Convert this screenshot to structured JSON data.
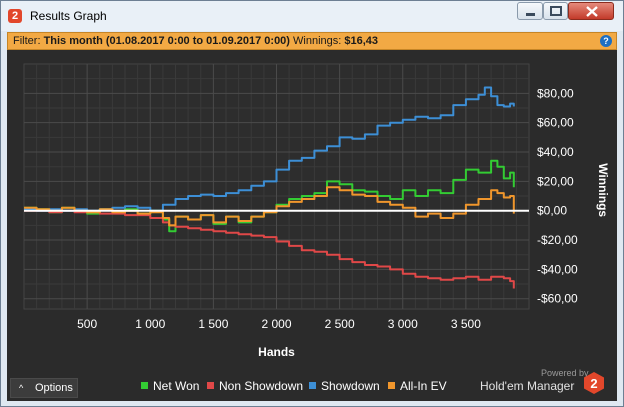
{
  "window": {
    "title": "Results Graph",
    "app_icon_glyph": "2",
    "controls": [
      "minimize-icon",
      "maximize-icon",
      "close-icon"
    ]
  },
  "filter": {
    "prefix": "Filter:",
    "range": "This month (01.08.2017 0:00 to 01.09.2017 0:00)",
    "winnings_label": "Winnings:",
    "winnings_value": "$16,43",
    "help_glyph": "?"
  },
  "chart_data": {
    "type": "line",
    "xlabel": "Hands",
    "ylabel": "Winnings",
    "x_ticks": [
      "500",
      "1 000",
      "1 500",
      "2 000",
      "2 500",
      "3 000",
      "3 500"
    ],
    "x_tick_values": [
      500,
      1000,
      1500,
      2000,
      2500,
      3000,
      3500
    ],
    "y_ticks": [
      "$80,00",
      "$60,00",
      "$40,00",
      "$20,00",
      "$0,00",
      "-$20,00",
      "-$40,00",
      "-$60,00"
    ],
    "y_tick_values": [
      80,
      60,
      40,
      20,
      0,
      -20,
      -40,
      -60
    ],
    "xlim": [
      0,
      4000
    ],
    "ylim": [
      -67,
      100
    ],
    "grid": true,
    "zero_line": true,
    "legend_position": "bottom-right",
    "series": [
      {
        "name": "Net Won",
        "color": "#33cc33",
        "points": [
          [
            0,
            2
          ],
          [
            100,
            1
          ],
          [
            200,
            -1
          ],
          [
            300,
            2
          ],
          [
            400,
            0
          ],
          [
            500,
            -2
          ],
          [
            600,
            1
          ],
          [
            700,
            -1
          ],
          [
            800,
            1
          ],
          [
            900,
            -2
          ],
          [
            1000,
            0
          ],
          [
            1100,
            -6
          ],
          [
            1150,
            -14
          ],
          [
            1200,
            -4
          ],
          [
            1300,
            -6
          ],
          [
            1400,
            -3
          ],
          [
            1500,
            -9
          ],
          [
            1600,
            -4
          ],
          [
            1700,
            -8
          ],
          [
            1800,
            -4
          ],
          [
            1900,
            -1
          ],
          [
            2000,
            4
          ],
          [
            2100,
            8
          ],
          [
            2200,
            10
          ],
          [
            2300,
            12
          ],
          [
            2400,
            20
          ],
          [
            2500,
            18
          ],
          [
            2600,
            14
          ],
          [
            2700,
            13
          ],
          [
            2800,
            10
          ],
          [
            2900,
            8
          ],
          [
            3000,
            14
          ],
          [
            3100,
            10
          ],
          [
            3200,
            14
          ],
          [
            3300,
            12
          ],
          [
            3400,
            21
          ],
          [
            3500,
            28
          ],
          [
            3600,
            26
          ],
          [
            3700,
            34
          ],
          [
            3750,
            30
          ],
          [
            3800,
            22
          ],
          [
            3850,
            26
          ],
          [
            3880,
            16
          ]
        ]
      },
      {
        "name": "Non Showdown",
        "color": "#e04848",
        "points": [
          [
            0,
            0
          ],
          [
            100,
            0
          ],
          [
            200,
            -1
          ],
          [
            300,
            0
          ],
          [
            400,
            -1
          ],
          [
            500,
            -1
          ],
          [
            600,
            -2
          ],
          [
            700,
            -2
          ],
          [
            800,
            -3
          ],
          [
            900,
            -3
          ],
          [
            1000,
            -5
          ],
          [
            1100,
            -8
          ],
          [
            1150,
            -10
          ],
          [
            1200,
            -11
          ],
          [
            1300,
            -12
          ],
          [
            1400,
            -13
          ],
          [
            1500,
            -14
          ],
          [
            1600,
            -15
          ],
          [
            1700,
            -16
          ],
          [
            1800,
            -17
          ],
          [
            1900,
            -18
          ],
          [
            2000,
            -21
          ],
          [
            2100,
            -24
          ],
          [
            2200,
            -27
          ],
          [
            2300,
            -28
          ],
          [
            2400,
            -30
          ],
          [
            2500,
            -33
          ],
          [
            2600,
            -35
          ],
          [
            2700,
            -37
          ],
          [
            2800,
            -38
          ],
          [
            2900,
            -40
          ],
          [
            3000,
            -43
          ],
          [
            3100,
            -45
          ],
          [
            3200,
            -46
          ],
          [
            3300,
            -47
          ],
          [
            3400,
            -46
          ],
          [
            3500,
            -45
          ],
          [
            3600,
            -47
          ],
          [
            3700,
            -45
          ],
          [
            3800,
            -46
          ],
          [
            3850,
            -48
          ],
          [
            3880,
            -53
          ]
        ]
      },
      {
        "name": "Showdown",
        "color": "#3d8fd6",
        "points": [
          [
            0,
            1
          ],
          [
            100,
            0
          ],
          [
            200,
            1
          ],
          [
            300,
            0
          ],
          [
            400,
            1
          ],
          [
            500,
            0
          ],
          [
            600,
            1
          ],
          [
            700,
            2
          ],
          [
            800,
            3
          ],
          [
            900,
            2
          ],
          [
            1000,
            0
          ],
          [
            1100,
            4
          ],
          [
            1200,
            8
          ],
          [
            1300,
            10
          ],
          [
            1400,
            11
          ],
          [
            1500,
            10
          ],
          [
            1600,
            12
          ],
          [
            1700,
            14
          ],
          [
            1800,
            17
          ],
          [
            1900,
            20
          ],
          [
            2000,
            28
          ],
          [
            2100,
            34
          ],
          [
            2200,
            36
          ],
          [
            2300,
            41
          ],
          [
            2400,
            44
          ],
          [
            2500,
            50
          ],
          [
            2600,
            49
          ],
          [
            2700,
            52
          ],
          [
            2800,
            58
          ],
          [
            2900,
            60
          ],
          [
            3000,
            62
          ],
          [
            3100,
            64
          ],
          [
            3200,
            63
          ],
          [
            3300,
            65
          ],
          [
            3400,
            72
          ],
          [
            3500,
            76
          ],
          [
            3600,
            79
          ],
          [
            3650,
            84
          ],
          [
            3700,
            78
          ],
          [
            3750,
            72
          ],
          [
            3800,
            71
          ],
          [
            3850,
            73
          ],
          [
            3880,
            71
          ]
        ]
      },
      {
        "name": "All-In EV",
        "color": "#f0962c",
        "points": [
          [
            0,
            2
          ],
          [
            100,
            1
          ],
          [
            200,
            0
          ],
          [
            300,
            2
          ],
          [
            400,
            0
          ],
          [
            500,
            -1
          ],
          [
            600,
            1
          ],
          [
            700,
            -1
          ],
          [
            800,
            0
          ],
          [
            900,
            -2
          ],
          [
            1000,
            -1
          ],
          [
            1100,
            -5
          ],
          [
            1150,
            -10
          ],
          [
            1200,
            -4
          ],
          [
            1300,
            -6
          ],
          [
            1400,
            -3
          ],
          [
            1500,
            -8
          ],
          [
            1600,
            -4
          ],
          [
            1700,
            -7
          ],
          [
            1800,
            -4
          ],
          [
            1900,
            -1
          ],
          [
            2000,
            3
          ],
          [
            2100,
            6
          ],
          [
            2200,
            8
          ],
          [
            2300,
            10
          ],
          [
            2400,
            16
          ],
          [
            2500,
            14
          ],
          [
            2600,
            11
          ],
          [
            2700,
            10
          ],
          [
            2800,
            6
          ],
          [
            2900,
            4
          ],
          [
            3000,
            2
          ],
          [
            3100,
            -4
          ],
          [
            3200,
            -2
          ],
          [
            3300,
            -5
          ],
          [
            3400,
            -2
          ],
          [
            3500,
            4
          ],
          [
            3600,
            8
          ],
          [
            3700,
            14
          ],
          [
            3750,
            12
          ],
          [
            3800,
            9
          ],
          [
            3850,
            10
          ],
          [
            3880,
            -2
          ]
        ]
      }
    ]
  },
  "footer": {
    "options_label": "Options",
    "options_chevron": "^",
    "powered_by": "Powered by",
    "brand": "Hold'em Manager",
    "logo_glyph": "2"
  }
}
